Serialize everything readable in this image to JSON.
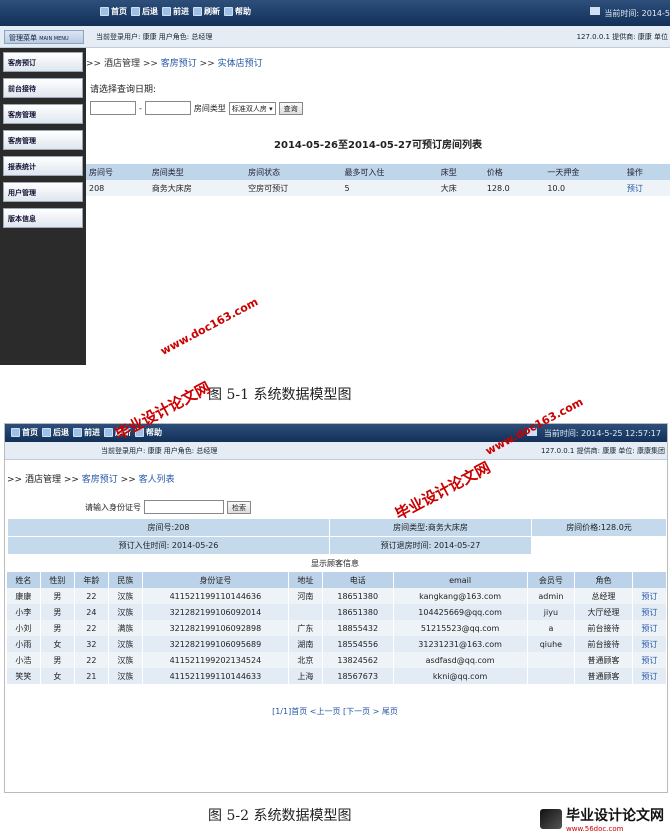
{
  "shot1": {
    "nav": [
      "首页",
      "后退",
      "前进",
      "刷新",
      "帮助"
    ],
    "time": "当前时间: 2014-5",
    "menu_title": "管理菜单",
    "menu_sub": "MAIN MENU",
    "current_user": "当前登录用户: 康康  用户角色: 总经理",
    "server_info": "127.0.0.1  提供商: 康康  单位",
    "sidebar": [
      "客房预订",
      "前台接待",
      "客房管理",
      "客房管理",
      "报表统计",
      "用户管理",
      "版本信息"
    ],
    "crumb": {
      "home": "酒店管理",
      "level2": "客房预订",
      "level3": "实体店预订"
    },
    "query_label": "请选择查询日期:",
    "date_start": "",
    "date_sep": "-",
    "date_end": "",
    "room_type_label": "房间类型",
    "room_type_value": "标准双人房",
    "query_button": "查询",
    "list_title": "2014-05-26至2014-05-27可预订房间列表",
    "table_headers": [
      "房间号",
      "房间类型",
      "房间状态",
      "最多可入住",
      "床型",
      "价格",
      "一天押金",
      "操作"
    ],
    "table_rows": [
      [
        "208",
        "商务大床房",
        "空房可预订",
        "5",
        "大床",
        "128.0",
        "10.0",
        "预订"
      ]
    ]
  },
  "caption1": "图 5-1  系统数据模型图",
  "shot2": {
    "nav": [
      "首页",
      "后退",
      "前进",
      "刷新",
      "帮助"
    ],
    "time": "当前时间: 2014-5-25 12:57:17",
    "current_user": "当前登录用户: 康康  用户角色: 总经理",
    "server_info": "127.0.0.1  提供商: 康康  单位: 康康集团",
    "crumb": {
      "home": "酒店管理",
      "level2": "客房预订",
      "level3": "客人列表"
    },
    "id_label": "请输入身份证号",
    "id_value": "",
    "search_button": "检索",
    "room_no": "房间号:208",
    "room_type": "房间类型:商务大床房",
    "room_price": "房间价格:128.0元",
    "checkin": "预订入住时间: 2014-05-26",
    "checkout": "预订退房时间: 2014-05-27",
    "guest_title": "显示顾客信息",
    "guest_headers": [
      "姓名",
      "性别",
      "年龄",
      "民族",
      "身份证号",
      "地址",
      "电话",
      "email",
      "会员号",
      "角色",
      ""
    ],
    "guest_rows": [
      [
        "康康",
        "男",
        "22",
        "汉族",
        "411521199110144636",
        "河南",
        "18651380",
        "kangkang@163.com",
        "admin",
        "总经理",
        "预订"
      ],
      [
        "小李",
        "男",
        "24",
        "汉族",
        "321282199106092014",
        "",
        "18651380",
        "104425669@qq.com",
        "jiyu",
        "大厅经理",
        "预订"
      ],
      [
        "小刘",
        "男",
        "22",
        "满族",
        "321282199106092898",
        "广东",
        "18855432",
        "51215523@qq.com",
        "a",
        "前台接待",
        "预订"
      ],
      [
        "小雨",
        "女",
        "32",
        "汉族",
        "321282199106095689",
        "湖南",
        "18554556",
        "31231231@163.com",
        "qiuhe",
        "前台接待",
        "预订"
      ],
      [
        "小浩",
        "男",
        "22",
        "汉族",
        "411521199202134524",
        "北京",
        "13824562",
        "asdfasd@qq.com",
        "",
        "普通顾客",
        "预订"
      ],
      [
        "笑笑",
        "女",
        "21",
        "汉族",
        "411521199110144633",
        "上海",
        "18567673",
        "kkni@qq.com",
        "",
        "普通顾客",
        "预订"
      ]
    ],
    "pager": "[1/1]首页 <上一页 [下一页 > 尾页"
  },
  "caption2": "图 5-2  系统数据模型图",
  "watermarks": {
    "doc": "www.doc163.com",
    "biye": "毕业设计论文网"
  },
  "logo": {
    "name": "毕业设计论文网",
    "url": "www.56doc.com"
  }
}
